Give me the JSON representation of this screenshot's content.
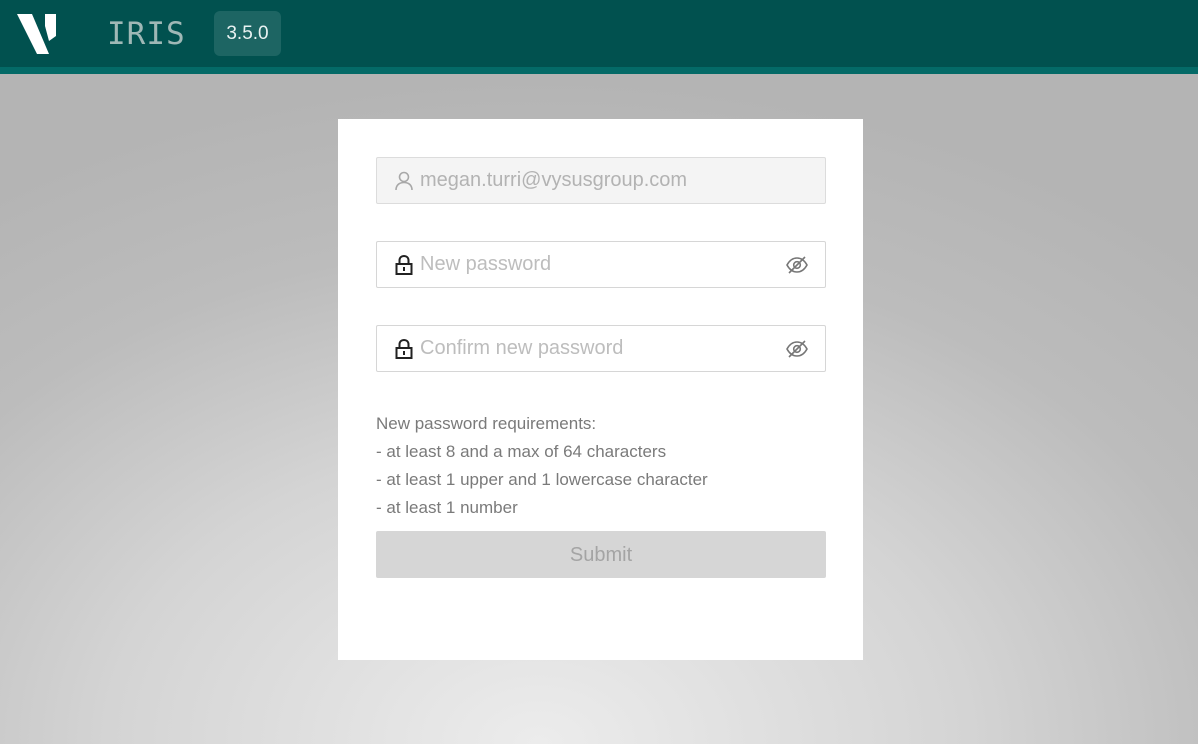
{
  "header": {
    "app_title": "IRIS",
    "version": "3.5.0",
    "background_color": "#01514f",
    "accent_color": "#046a67"
  },
  "form": {
    "username": {
      "value": "megan.turri@vysusgroup.com",
      "icon": "user-icon",
      "disabled": true
    },
    "new_password": {
      "placeholder": "New password",
      "icon": "lock-icon",
      "toggle_icon": "eye-slash-icon"
    },
    "confirm_password": {
      "placeholder": "Confirm new password",
      "icon": "lock-icon",
      "toggle_icon": "eye-slash-icon"
    },
    "requirements": {
      "heading": "New password requirements:",
      "items": [
        "- at least 8 and a max of 64 characters",
        "- at least 1 upper and 1 lowercase character",
        "- at least 1 number"
      ]
    },
    "submit_label": "Submit"
  }
}
